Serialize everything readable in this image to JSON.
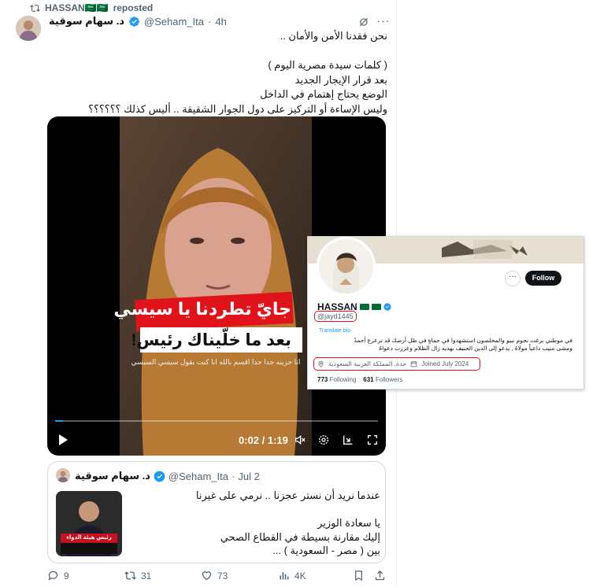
{
  "repost": {
    "user": "HASSAN🇸🇦🇸🇦",
    "label": "reposted"
  },
  "post": {
    "author_name": "د. سهام سوقية",
    "handle": "@Seham_Ita",
    "separator": "·",
    "time": "4h",
    "lines": [
      "نحن فقدنا الأمن والأمان ..",
      "",
      "( كلمات سيدة مصرية اليوم )",
      "بعد قرار الإيجار الجديد",
      "الوضع يحتاج إهتمام في الداخل",
      "وليس الإساءة أو التركيز على دول الجوار الشقيقة .. أليس كذلك  ؟؟؟؟؟؟"
    ]
  },
  "video": {
    "caption_line1": "جايّ تطردنا يا سيسي",
    "caption_line2": "بعد ما خلّيناك رئيس!",
    "subtitle": "انا حزينه جدا جدا اقسم بالله انا كنت بقول سيسي السيسي",
    "time": "0:02 / 1:19",
    "progress_fraction": 0.025
  },
  "profile_card": {
    "name": "HASSAN",
    "follow_label": "Follow",
    "handle": "@jayd1445",
    "translate": "Translate bio",
    "bio_line1": "في موطني برغت نجوم نبيو والمخلصون استشهدوا في حماةٍ في ظل أرضك قد ترعرع أحمدٌ",
    "bio_line2": "ومشى منيب داعياً مولاهُ , يدعو إلى الدين الحنيف بهديه زال الظلام وعززت دعواهُ",
    "location": "جدة, المملكة العربية السعودية",
    "joined": "Joined July 2024",
    "following_count": "773",
    "following_label": "Following",
    "followers_count": "631",
    "followers_label": "Followers"
  },
  "quote": {
    "author_name": "د. سهام سوقية",
    "handle": "@Seham_Ita",
    "separator": "·",
    "time": "Jul 2",
    "thumb_label": "رئيس هيئة الدواء",
    "lines": [
      "عندما نريد أن نستر عجزنا .. نرمي على غيرنا",
      "",
      "يا سعادة الوزير",
      "إليك مقارنة بسيطة في القطاع الصحي",
      "بين ( مصر - السعودية ) ..."
    ]
  },
  "actions": {
    "replies": "9",
    "reposts": "31",
    "likes": "73",
    "views": "4K"
  },
  "colors": {
    "verified": "#1d9bf0",
    "highlight": "#e0131b",
    "muted": "#536471"
  }
}
